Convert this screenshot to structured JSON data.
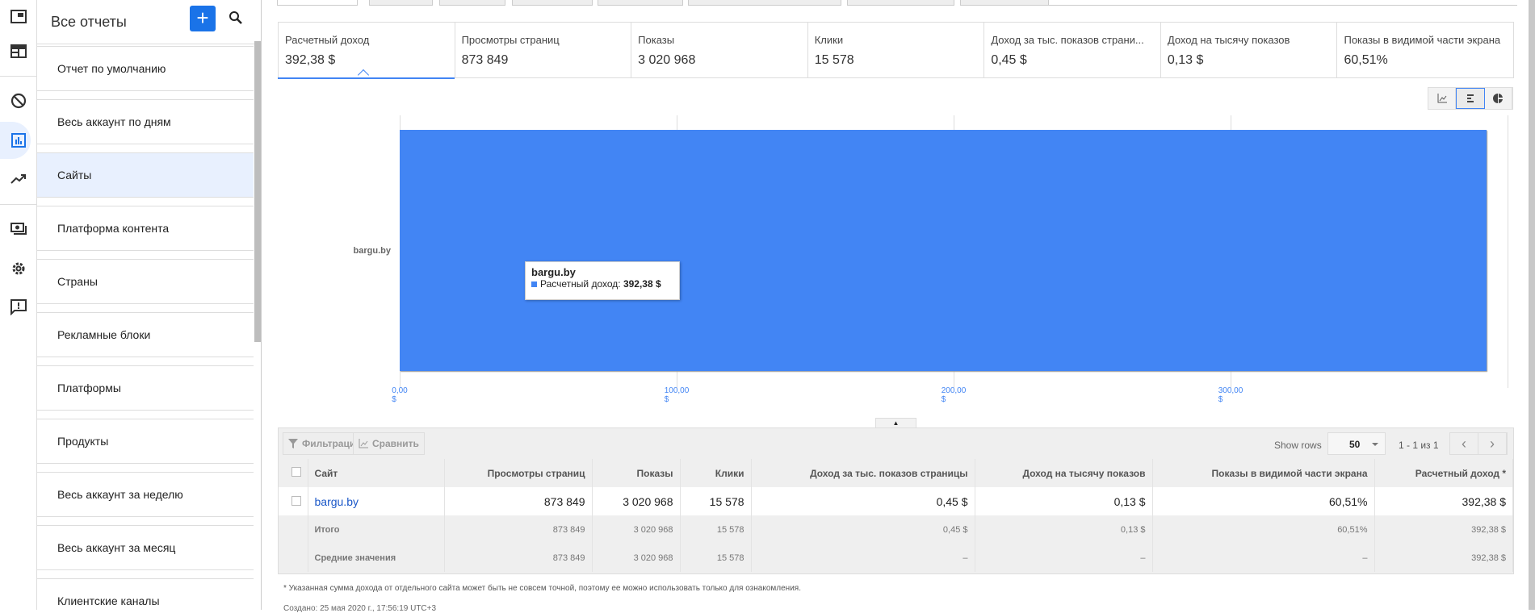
{
  "sidebar": {
    "title": "Все отчеты",
    "add_label": "+",
    "items": [
      {
        "label": "Отчет по умолчанию"
      },
      {
        "label": "Весь аккаунт по дням"
      },
      {
        "label": "Сайты",
        "selected": true
      },
      {
        "label": "Платформа контента"
      },
      {
        "label": "Страны"
      },
      {
        "label": "Рекламные блоки"
      },
      {
        "label": "Платформы"
      },
      {
        "label": "Продукты"
      },
      {
        "label": "Весь аккаунт за неделю"
      },
      {
        "label": "Весь аккаунт за месяц"
      },
      {
        "label": "Клиентские каналы"
      }
    ]
  },
  "metrics": [
    {
      "label": "Расчетный доход",
      "value": "392,38 $"
    },
    {
      "label": "Просмотры страниц",
      "value": "873 849"
    },
    {
      "label": "Показы",
      "value": "3 020 968"
    },
    {
      "label": "Клики",
      "value": "15 578"
    },
    {
      "label": "Доход за тыс. показов страни...",
      "value": "0,45 $"
    },
    {
      "label": "Доход на тысячу показов",
      "value": "0,13 $"
    },
    {
      "label": "Показы в видимой части экрана",
      "value": "60,51%"
    }
  ],
  "chart_data": {
    "type": "bar",
    "orientation": "horizontal",
    "categories": [
      "bargu.by"
    ],
    "series": [
      {
        "name": "Расчетный доход",
        "values": [
          392.38
        ]
      }
    ],
    "xticks": [
      "0,00 $",
      "100,00 $",
      "200,00 $",
      "300,00 $"
    ],
    "xlim": [
      0,
      400
    ],
    "color": "#4285f4",
    "tooltip": {
      "title": "bargu.by",
      "label": "Расчетный доход:",
      "value": "392,38 $"
    }
  },
  "toolbar": {
    "filter": "Фильтрация",
    "compare": "Сравнить",
    "show_rows": "Show rows",
    "rows": "50",
    "pagination": "1 - 1 из 1"
  },
  "table": {
    "columns": [
      "Сайт",
      "Просмотры страниц",
      "Показы",
      "Клики",
      "Доход за тыс. показов страницы",
      "Доход на тысячу показов",
      "Показы в видимой части экрана",
      "Расчетный доход *"
    ],
    "rows": [
      [
        "bargu.by",
        "873 849",
        "3 020 968",
        "15 578",
        "0,45 $",
        "0,13 $",
        "60,51%",
        "392,38 $"
      ]
    ],
    "summary": [
      [
        "Итого",
        "873 849",
        "3 020 968",
        "15 578",
        "0,45 $",
        "0,13 $",
        "60,51%",
        "392,38 $"
      ],
      [
        "Средние значения",
        "873 849",
        "3 020 968",
        "15 578",
        "–",
        "–",
        "–",
        "392,38 $"
      ]
    ]
  },
  "footnote": "* Указанная сумма дохода от отдельного сайта может быть не совсем точной, поэтому ее можно использовать только для ознакомления.",
  "created": "Создано: 25 мая 2020 г., 17:56:19 UTC+3"
}
